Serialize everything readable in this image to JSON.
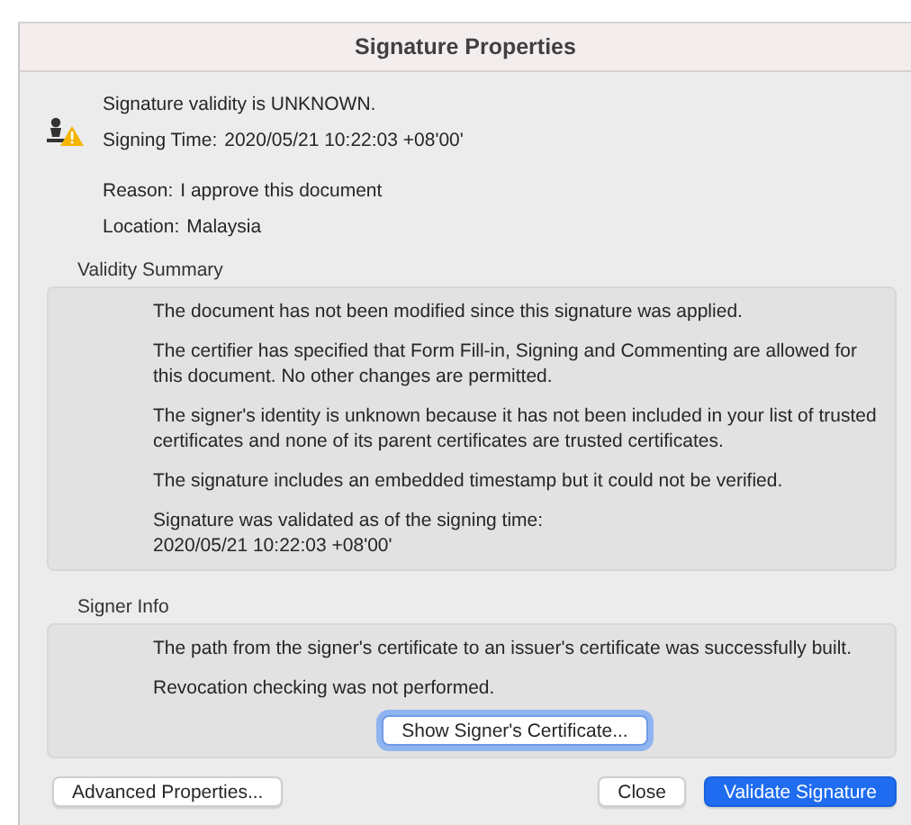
{
  "window": {
    "title": "Signature Properties"
  },
  "header": {
    "status": "Signature validity is UNKNOWN.",
    "signing_time_label": "Signing Time:",
    "signing_time": "2020/05/21 10:22:03 +08'00'",
    "reason_label": "Reason:",
    "reason": "I approve this document",
    "location_label": "Location:",
    "location": "Malaysia"
  },
  "validity_summary": {
    "title": "Validity Summary",
    "paragraphs": [
      "The document has not been modified since this signature was applied.",
      "The certifier has specified that Form Fill-in, Signing and Commenting are allowed for this document. No other changes are permitted.",
      "The signer's identity is unknown because it has not been included in your list of trusted certificates and none of its parent certificates are trusted certificates.",
      "The signature includes an embedded timestamp but it could not be verified.",
      "Signature was validated as of the signing time:\n2020/05/21 10:22:03 +08'00'"
    ]
  },
  "signer_info": {
    "title": "Signer Info",
    "paragraphs": [
      "The path from the signer's certificate to an issuer's certificate was successfully built.",
      "Revocation checking was not performed."
    ],
    "button": {
      "label": "Show Signer's Certificate...",
      "focused": true
    }
  },
  "buttons": [
    {
      "label": "Advanced Properties...",
      "default": false
    },
    {
      "label": "Close",
      "default": false
    },
    {
      "label": "Validate Signature",
      "default": true
    }
  ]
}
